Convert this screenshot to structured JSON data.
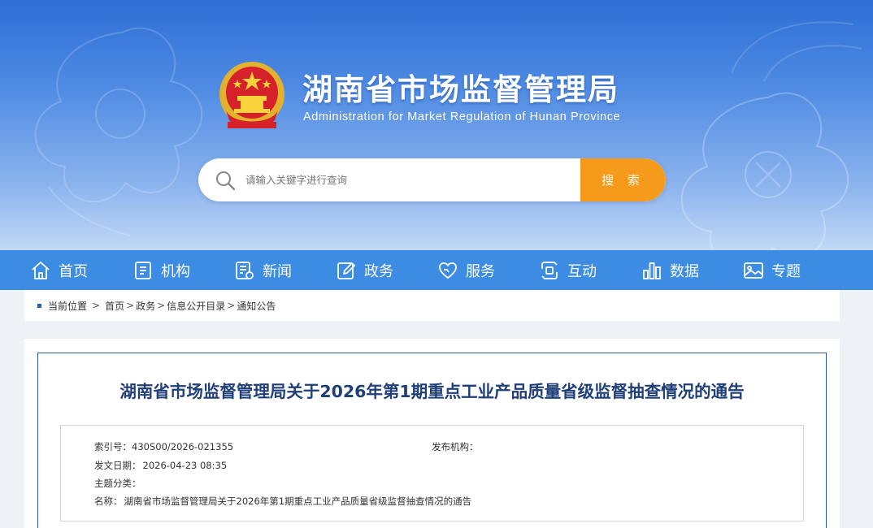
{
  "header": {
    "title": "湖南省市场监督管理局",
    "subtitle": "Administration for Market Regulation of Hunan Province",
    "logo_icon": "national-emblem-icon"
  },
  "search": {
    "placeholder": "请输入关键字进行查询",
    "value": "",
    "button_label": "搜  索",
    "button_color": "#f59a1a"
  },
  "nav": {
    "bar_color": "#3d8ce4",
    "items": [
      {
        "label": "首页",
        "icon": "home-icon"
      },
      {
        "label": "机构",
        "icon": "document-icon"
      },
      {
        "label": "新闻",
        "icon": "news-icon"
      },
      {
        "label": "政务",
        "icon": "edit-icon"
      },
      {
        "label": "服务",
        "icon": "service-icon"
      },
      {
        "label": "互动",
        "icon": "interaction-icon"
      },
      {
        "label": "数据",
        "icon": "bar-chart-icon"
      },
      {
        "label": "专题",
        "icon": "image-icon"
      }
    ]
  },
  "breadcrumb": {
    "label": "当前位置",
    "sep": ">",
    "items": [
      "首页",
      "政务",
      "信息公开目录",
      "通知公告"
    ]
  },
  "article": {
    "title": "湖南省市场监督管理局关于2026年第1期重点工业产品质量省级监督抽查情况的通告",
    "title_color": "#1f3f78",
    "meta": {
      "index_label": "索引号：",
      "index_value": "430S00/2026-021355",
      "publisher_label": "发布机构：",
      "publisher_value": "",
      "date_label": "发文日期：",
      "date_value": "2026-04-23 08:35",
      "category_label": "主题分类：",
      "category_value": "",
      "name_label": "名称：",
      "name_value": "湖南省市场监督管理局关于2026年第1期重点工业产品质量省级监督抽查情况的通告"
    }
  }
}
